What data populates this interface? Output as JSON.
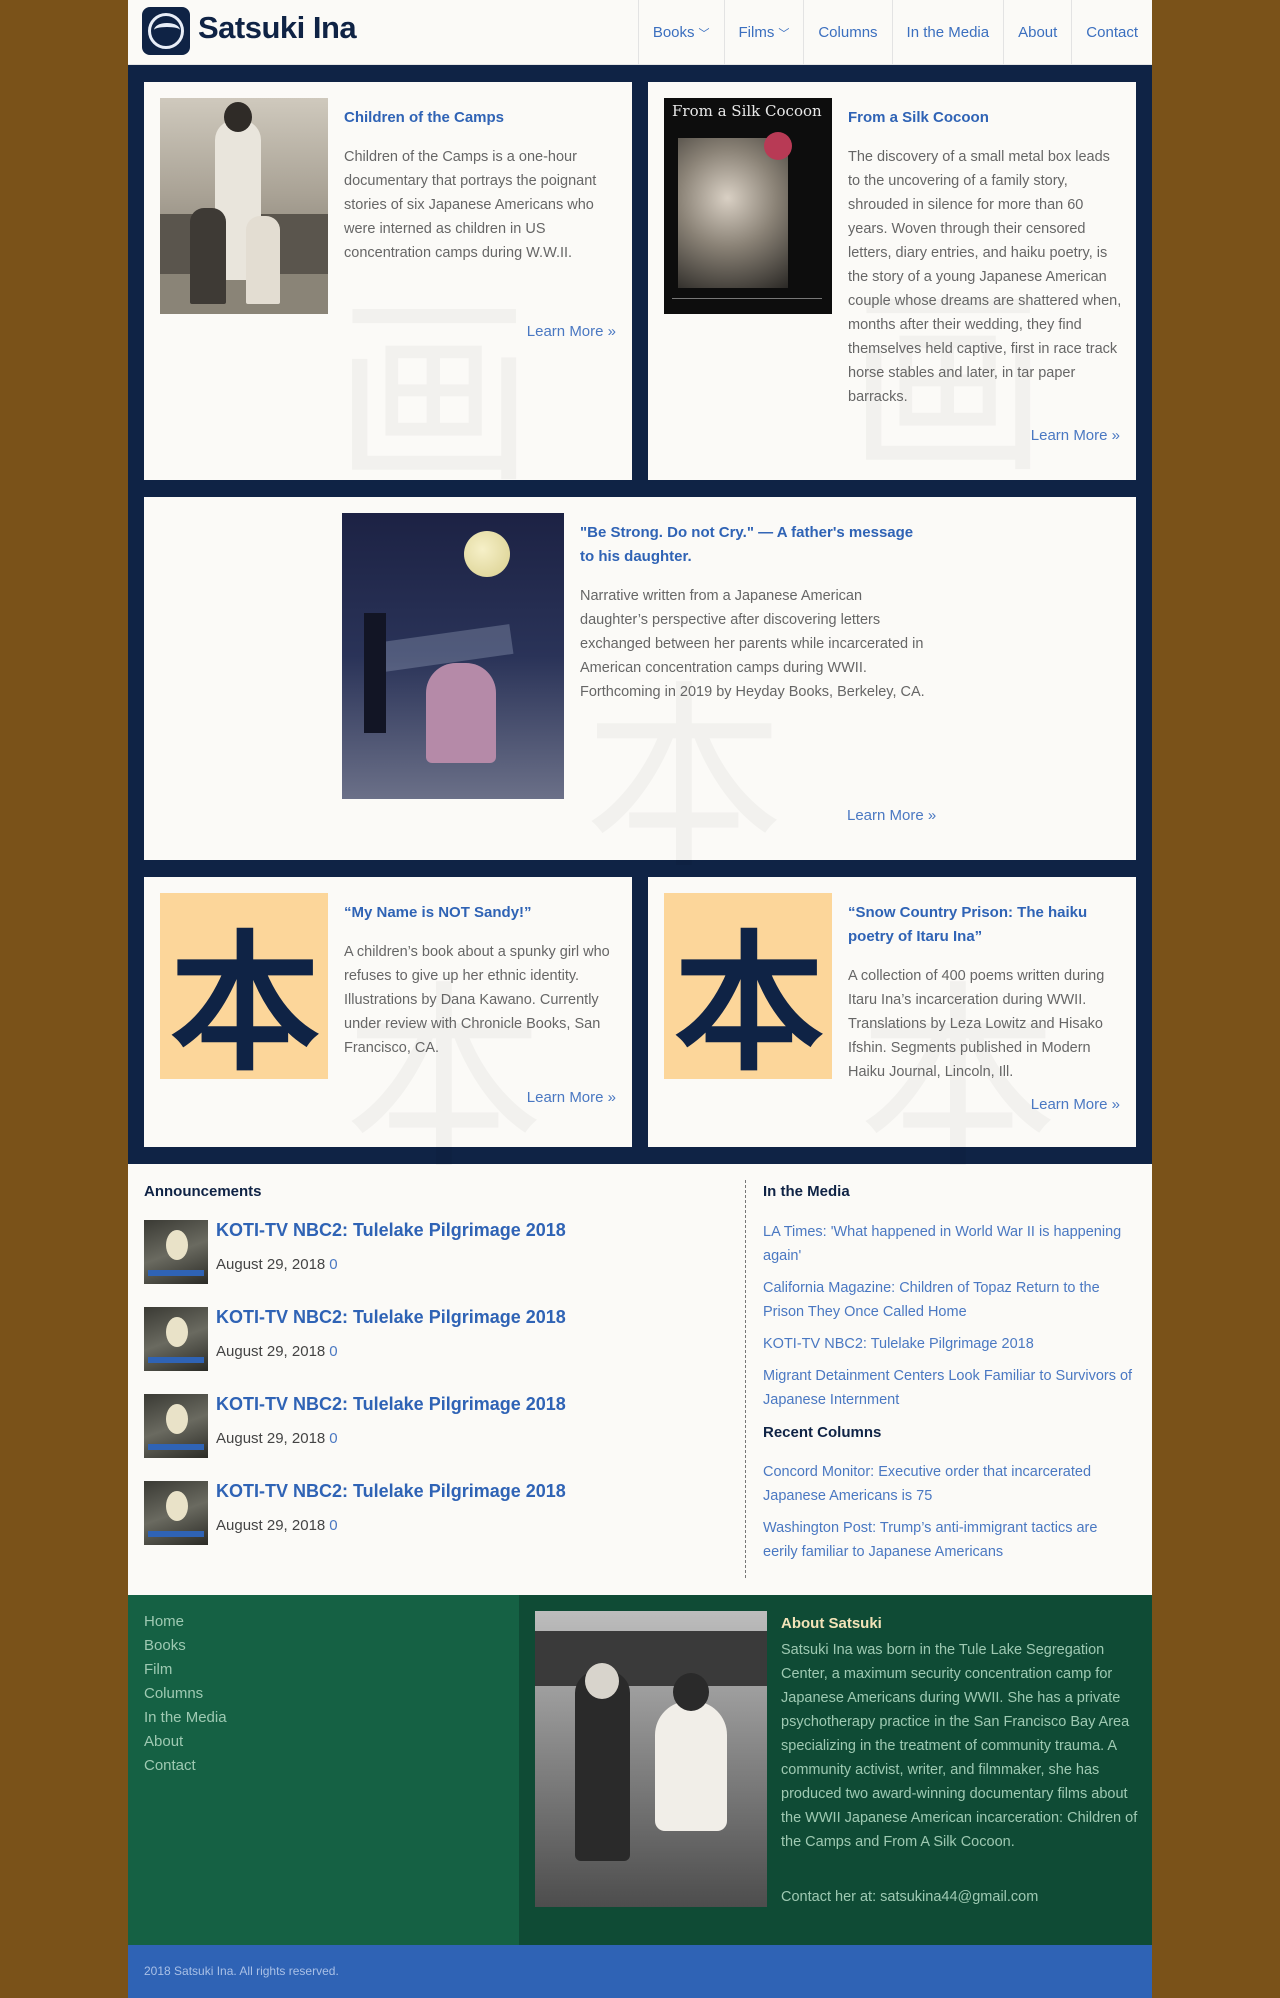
{
  "header": {
    "site_title": "Satsuki Ina",
    "nav": [
      {
        "label": "Books",
        "dropdown": true
      },
      {
        "label": "Films",
        "dropdown": true
      },
      {
        "label": "Columns",
        "dropdown": false
      },
      {
        "label": "In the Media",
        "dropdown": false
      },
      {
        "label": "About",
        "dropdown": false
      },
      {
        "label": "Contact",
        "dropdown": false
      }
    ]
  },
  "features": [
    {
      "title": "Children of the Camps",
      "description": "Children of the Camps is a one-hour documentary that portrays the poignant stories of six Japanese Americans who were interned as children in US concentration camps during W.W.II.",
      "link": "Learn More »"
    },
    {
      "title": "From a Silk Cocoon",
      "poster_title": "From a Silk Cocoon",
      "description": "The discovery of a small metal box leads to the uncovering of a family story, shrouded in silence for more than 60 years. Woven through their censored letters, diary entries, and haiku poetry, is the story of a young Japanese American couple whose dreams are shattered when, months after their wedding, they find themselves held captive, first in race track horse stables and later, in tar paper barracks.",
      "link": "Learn More »"
    },
    {
      "title": "\"Be Strong. Do not Cry.\" — A father's message to his daughter.",
      "description": "Narrative written from a Japanese American daughter’s perspective after discovering letters exchanged between her parents while incarcerated in American concentration camps during WWII. Forthcoming in 2019 by Heyday Books, Berkeley, CA.",
      "link": "Learn More »"
    },
    {
      "title": "“My Name is NOT Sandy!”",
      "description": "A children’s book about a spunky girl who refuses to give up her ethnic identity. Illustrations by Dana Kawano. Currently under review with Chronicle Books, San Francisco, CA.",
      "link": "Learn More »"
    },
    {
      "title": "“Snow Country Prison: The haiku poetry of Itaru Ina”",
      "description": "A collection of 400 poems written during Itaru Ina’s incarceration during WWII. Translations by Leza Lowitz and Hisako Ifshin. Segments published in Modern Haiku Journal, Lincoln, Ill.",
      "link": "Learn More »"
    }
  ],
  "kanji_glyph": "本",
  "announcements": {
    "heading": "Announcements",
    "items": [
      {
        "title": "KOTI-TV NBC2: Tulelake Pilgrimage 2018",
        "date": "August 29, 2018",
        "comments": "0"
      },
      {
        "title": "KOTI-TV NBC2: Tulelake Pilgrimage 2018",
        "date": "August 29, 2018",
        "comments": "0"
      },
      {
        "title": "KOTI-TV NBC2: Tulelake Pilgrimage 2018",
        "date": "August 29, 2018",
        "comments": "0"
      },
      {
        "title": "KOTI-TV NBC2: Tulelake Pilgrimage 2018",
        "date": "August 29, 2018",
        "comments": "0"
      }
    ]
  },
  "in_the_media": {
    "heading": "In the Media",
    "links": [
      "LA Times: 'What happened in World War II is happening again'",
      "California Magazine: Children of Topaz Return to the Prison They Once Called Home",
      "KOTI-TV NBC2: Tulelake Pilgrimage 2018",
      "Migrant Detainment Centers Look Familiar to Survivors of Japanese Internment"
    ]
  },
  "recent_columns": {
    "heading": "Recent Columns",
    "links": [
      "Concord Monitor: Executive order that incarcerated Japanese Americans is 75",
      "Washington Post: Trump’s anti-immigrant tactics are eerily familiar to Japanese Americans"
    ]
  },
  "footer": {
    "links": [
      "Home",
      "Books",
      "Film",
      "Columns",
      "In the Media",
      "About",
      "Contact"
    ],
    "about_title": "About Satsuki",
    "about_text": "Satsuki Ina was born in the Tule Lake Segregation Center, a maximum security concentration camp for Japanese Americans during WWII. She has a private psychotherapy practice in the San Francisco Bay Area specializing in the treatment of community trauma. A community activist, writer, and filmmaker, she has produced two award-winning documentary films about the WWII Japanese American incarceration: Children of the Camps and From A Silk Cocoon.",
    "contact_text": "Contact her at: satsukina44@gmail.com",
    "copyright": "2018 Satsuki Ina. All rights reserved."
  },
  "colors": {
    "background": "#7a5219",
    "navy": "#0f2345",
    "link_blue": "#2f63b5",
    "footer_green": "#156144",
    "footer_dark_green": "#0f4b35",
    "copyright_blue": "#2f63b5"
  }
}
